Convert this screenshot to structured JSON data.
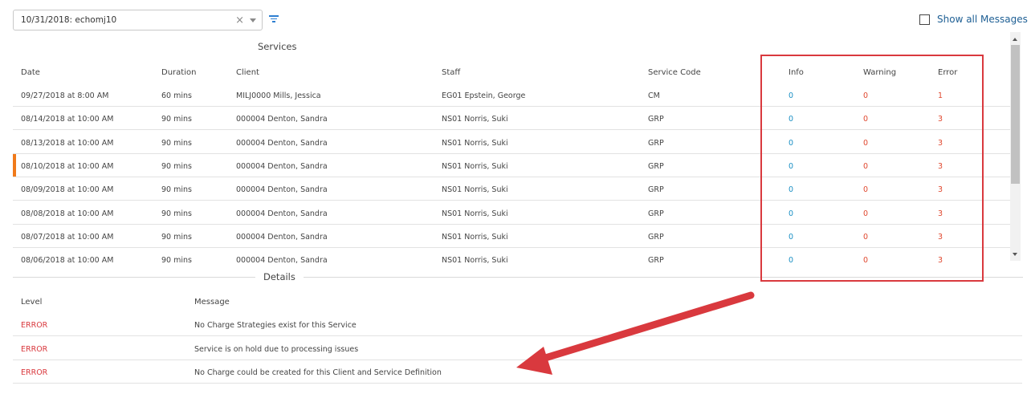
{
  "filter": {
    "selected_value": "10/31/2018: echomj10",
    "clear_symbol": "×",
    "icon": "filter-icon"
  },
  "show_all_messages": {
    "label": "Show all Messages",
    "checked": false
  },
  "services": {
    "title": "Services",
    "columns": {
      "date": "Date",
      "duration": "Duration",
      "client": "Client",
      "staff": "Staff",
      "service_code": "Service Code",
      "info": "Info",
      "warning": "Warning",
      "error": "Error"
    },
    "rows": [
      {
        "date": "09/27/2018 at 8:00 AM",
        "duration": "60 mins",
        "client": "MILJ0000 Mills, Jessica",
        "staff": "EG01 Epstein, George",
        "service_code": "CM",
        "info": "0",
        "warning": "0",
        "error": "1",
        "selected": false
      },
      {
        "date": "08/14/2018 at 10:00 AM",
        "duration": "90 mins",
        "client": "000004 Denton, Sandra",
        "staff": "NS01 Norris, Suki",
        "service_code": "GRP",
        "info": "0",
        "warning": "0",
        "error": "3",
        "selected": false
      },
      {
        "date": "08/13/2018 at 10:00 AM",
        "duration": "90 mins",
        "client": "000004 Denton, Sandra",
        "staff": "NS01 Norris, Suki",
        "service_code": "GRP",
        "info": "0",
        "warning": "0",
        "error": "3",
        "selected": false
      },
      {
        "date": "08/10/2018 at 10:00 AM",
        "duration": "90 mins",
        "client": "000004 Denton, Sandra",
        "staff": "NS01 Norris, Suki",
        "service_code": "GRP",
        "info": "0",
        "warning": "0",
        "error": "3",
        "selected": true
      },
      {
        "date": "08/09/2018 at 10:00 AM",
        "duration": "90 mins",
        "client": "000004 Denton, Sandra",
        "staff": "NS01 Norris, Suki",
        "service_code": "GRP",
        "info": "0",
        "warning": "0",
        "error": "3",
        "selected": false
      },
      {
        "date": "08/08/2018 at 10:00 AM",
        "duration": "90 mins",
        "client": "000004 Denton, Sandra",
        "staff": "NS01 Norris, Suki",
        "service_code": "GRP",
        "info": "0",
        "warning": "0",
        "error": "3",
        "selected": false
      },
      {
        "date": "08/07/2018 at 10:00 AM",
        "duration": "90 mins",
        "client": "000004 Denton, Sandra",
        "staff": "NS01 Norris, Suki",
        "service_code": "GRP",
        "info": "0",
        "warning": "0",
        "error": "3",
        "selected": false
      },
      {
        "date": "08/06/2018 at 10:00 AM",
        "duration": "90 mins",
        "client": "000004 Denton, Sandra",
        "staff": "NS01 Norris, Suki",
        "service_code": "GRP",
        "info": "0",
        "warning": "0",
        "error": "3",
        "selected": false
      }
    ]
  },
  "details": {
    "title": "Details",
    "columns": {
      "level": "Level",
      "message": "Message"
    },
    "rows": [
      {
        "level": "ERROR",
        "message": "No Charge Strategies exist for this Service"
      },
      {
        "level": "ERROR",
        "message": "Service is on hold due to processing issues"
      },
      {
        "level": "ERROR",
        "message": "No Charge could be created for this Client and Service Definition"
      }
    ]
  },
  "colors": {
    "info": "#1a8fc4",
    "warning": "#e0482f",
    "error": "#e0482f",
    "level_error": "#d9393e",
    "selected_marker": "#f07a1a",
    "annotation": "#d9393e",
    "link": "#1e5f94"
  }
}
